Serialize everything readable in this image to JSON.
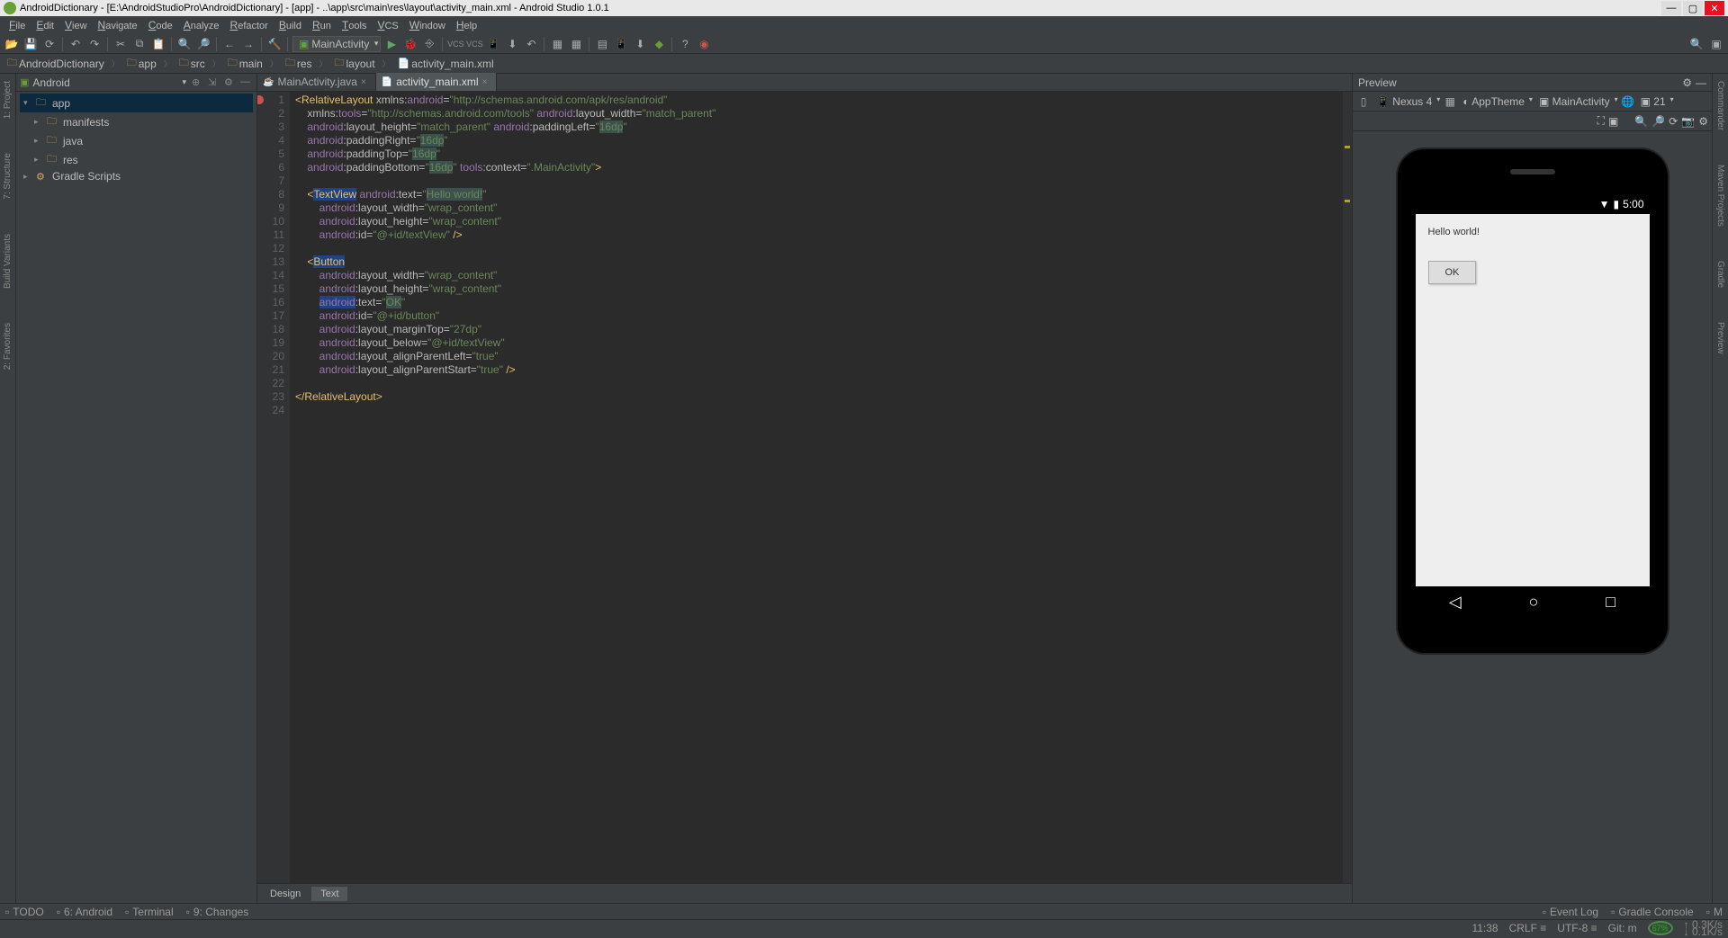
{
  "titlebar": {
    "text": "AndroidDictionary - [E:\\AndroidStudioPro\\AndroidDictionary] - [app] - ..\\app\\src\\main\\res\\layout\\activity_main.xml - Android Studio 1.0.1"
  },
  "menubar": [
    "File",
    "Edit",
    "View",
    "Navigate",
    "Code",
    "Analyze",
    "Refactor",
    "Build",
    "Run",
    "Tools",
    "VCS",
    "Window",
    "Help"
  ],
  "toolbar": {
    "run_config": "MainActivity"
  },
  "breadcrumb": [
    "AndroidDictionary",
    "app",
    "src",
    "main",
    "res",
    "layout",
    "activity_main.xml"
  ],
  "project": {
    "view": "Android",
    "nodes": [
      {
        "label": "app",
        "type": "module",
        "expanded": true,
        "indent": 0,
        "selected": true
      },
      {
        "label": "manifests",
        "type": "folder",
        "indent": 1
      },
      {
        "label": "java",
        "type": "folder",
        "indent": 1
      },
      {
        "label": "res",
        "type": "folder",
        "indent": 1
      },
      {
        "label": "Gradle Scripts",
        "type": "gradle",
        "indent": 0
      }
    ]
  },
  "editor": {
    "tabs": [
      {
        "label": "MainActivity.java",
        "icon": "☕",
        "active": false
      },
      {
        "label": "activity_main.xml",
        "icon": "📄",
        "active": true
      }
    ],
    "footer_tabs": [
      "Design",
      "Text"
    ],
    "footer_active": "Text",
    "line_count": 24,
    "code_lines": [
      {
        "n": 1,
        "html": "<span class='tag'>&lt;RelativeLayout</span> <span class='attr'>xmlns:</span><span class='ns'>android</span><span class='attr'>=</span><span class='val'>\"http://schemas.android.com/apk/res/android\"</span>"
      },
      {
        "n": 2,
        "html": "    <span class='attr'>xmlns:</span><span class='ns'>tools</span><span class='attr'>=</span><span class='val'>\"http://schemas.android.com/tools\"</span> <span class='ns'>android</span><span class='attr'>:layout_width=</span><span class='val'>\"match_parent\"</span>"
      },
      {
        "n": 3,
        "html": "    <span class='ns'>android</span><span class='attr'>:layout_height=</span><span class='val'>\"match_parent\"</span> <span class='ns'>android</span><span class='attr'>:paddingLeft=</span><span class='val'>\"<span class='hl2'>16dp</span>\"</span>"
      },
      {
        "n": 4,
        "html": "    <span class='ns'>android</span><span class='attr'>:paddingRight=</span><span class='val'>\"<span class='hl2'>16dp</span>\"</span>"
      },
      {
        "n": 5,
        "html": "    <span class='ns'>android</span><span class='attr'>:paddingTop=</span><span class='val'>\"<span class='hl2'>16dp</span>\"</span>"
      },
      {
        "n": 6,
        "html": "    <span class='ns'>android</span><span class='attr'>:paddingBottom=</span><span class='val'>\"<span class='hl2'>16dp</span>\"</span> <span class='ns'>tools</span><span class='attr'>:context=</span><span class='val'>\".MainActivity\"</span><span class='tag'>&gt;</span>"
      },
      {
        "n": 7,
        "html": ""
      },
      {
        "n": 8,
        "html": "    <span class='tag'>&lt;<span class='hl'>TextView</span></span> <span class='ns'>android</span><span class='attr'>:text=</span><span class='val'>\"<span class='hl2'>Hello world!</span>\"</span>"
      },
      {
        "n": 9,
        "html": "        <span class='ns'>android</span><span class='attr'>:layout_width=</span><span class='val'>\"wrap_content\"</span>"
      },
      {
        "n": 10,
        "html": "        <span class='ns'>android</span><span class='attr'>:layout_height=</span><span class='val'>\"wrap_content\"</span>"
      },
      {
        "n": 11,
        "html": "        <span class='ns'>android</span><span class='attr'>:id=</span><span class='val'>\"@+id/textView\"</span> <span class='tag'>/&gt;</span>"
      },
      {
        "n": 12,
        "html": ""
      },
      {
        "n": 13,
        "html": "    <span class='tag'>&lt;<span class='hl'>Button</span></span>"
      },
      {
        "n": 14,
        "html": "        <span class='ns'>android</span><span class='attr'>:layout_width=</span><span class='val'>\"wrap_content\"</span>"
      },
      {
        "n": 15,
        "html": "        <span class='ns'>android</span><span class='attr'>:layout_height=</span><span class='val'>\"wrap_content\"</span>"
      },
      {
        "n": 16,
        "html": "        <span class='ns hl'>android</span><span class='attr'>:text=</span><span class='val'>\"<span class='hl2'>OK</span>\"</span>"
      },
      {
        "n": 17,
        "html": "        <span class='ns'>android</span><span class='attr'>:id=</span><span class='val'>\"@+id/button\"</span>"
      },
      {
        "n": 18,
        "html": "        <span class='ns'>android</span><span class='attr'>:layout_marginTop=</span><span class='val'>\"27dp\"</span>"
      },
      {
        "n": 19,
        "html": "        <span class='ns'>android</span><span class='attr'>:layout_below=</span><span class='val'>\"@+id/textView\"</span>"
      },
      {
        "n": 20,
        "html": "        <span class='ns'>android</span><span class='attr'>:layout_alignParentLeft=</span><span class='val'>\"true\"</span>"
      },
      {
        "n": 21,
        "html": "        <span class='ns'>android</span><span class='attr'>:layout_alignParentStart=</span><span class='val'>\"true\"</span> <span class='tag'>/&gt;</span>"
      },
      {
        "n": 22,
        "html": ""
      },
      {
        "n": 23,
        "html": "<span class='tag'>&lt;/RelativeLayout&gt;</span>"
      },
      {
        "n": 24,
        "html": ""
      }
    ]
  },
  "preview": {
    "title": "Preview",
    "device": "Nexus 4",
    "theme": "AppTheme",
    "activity": "MainActivity",
    "api": "21",
    "status_time": "5:00",
    "hello_text": "Hello world!",
    "button_text": "OK"
  },
  "left_tabs": [
    "1: Project",
    "7: Structure",
    "Build Variants",
    "2: Favorites"
  ],
  "right_tabs": [
    "Commander",
    "Maven Projects",
    "Gradle",
    "Preview"
  ],
  "bottom_tabs": {
    "left": [
      "TODO",
      "6: Android",
      "Terminal",
      "9: Changes"
    ],
    "right": [
      "Event Log",
      "Gradle Console",
      "M"
    ]
  },
  "statusbar": {
    "pos": "11:38",
    "line_sep": "CRLF",
    "encoding": "UTF-8",
    "git": "Git: m",
    "mem": "67%",
    "net_up": "0.3K/s",
    "net_dn": "0.1K/s"
  }
}
